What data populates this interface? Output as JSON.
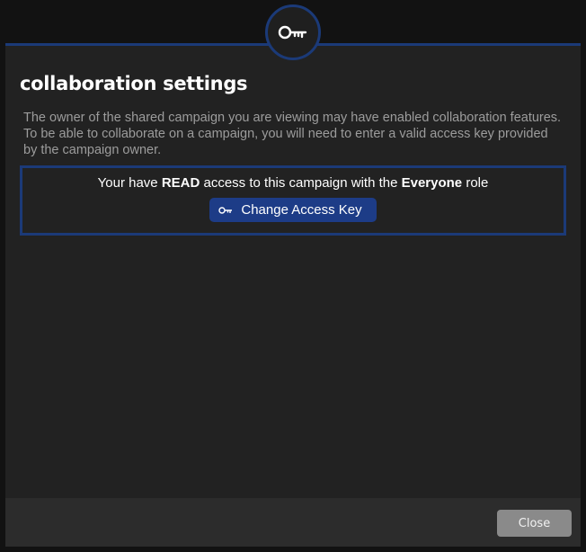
{
  "dialog": {
    "title": "collaboration settings",
    "description": "The owner of the shared campaign you are viewing may have enabled collaboration features. To be able to collaborate on a campaign, you will need to enter a valid access key provided by the campaign owner."
  },
  "access": {
    "prefix": "Your have ",
    "level": "READ",
    "middle": " access to this campaign with the ",
    "role": "Everyone",
    "suffix": " role",
    "change_button_label": "Change Access Key"
  },
  "footer": {
    "close_label": "Close"
  },
  "icons": {
    "badge": "key-icon",
    "button": "key-icon"
  },
  "colors": {
    "accent": "#1b3a78",
    "button": "#1d3c87",
    "background": "#222222"
  }
}
